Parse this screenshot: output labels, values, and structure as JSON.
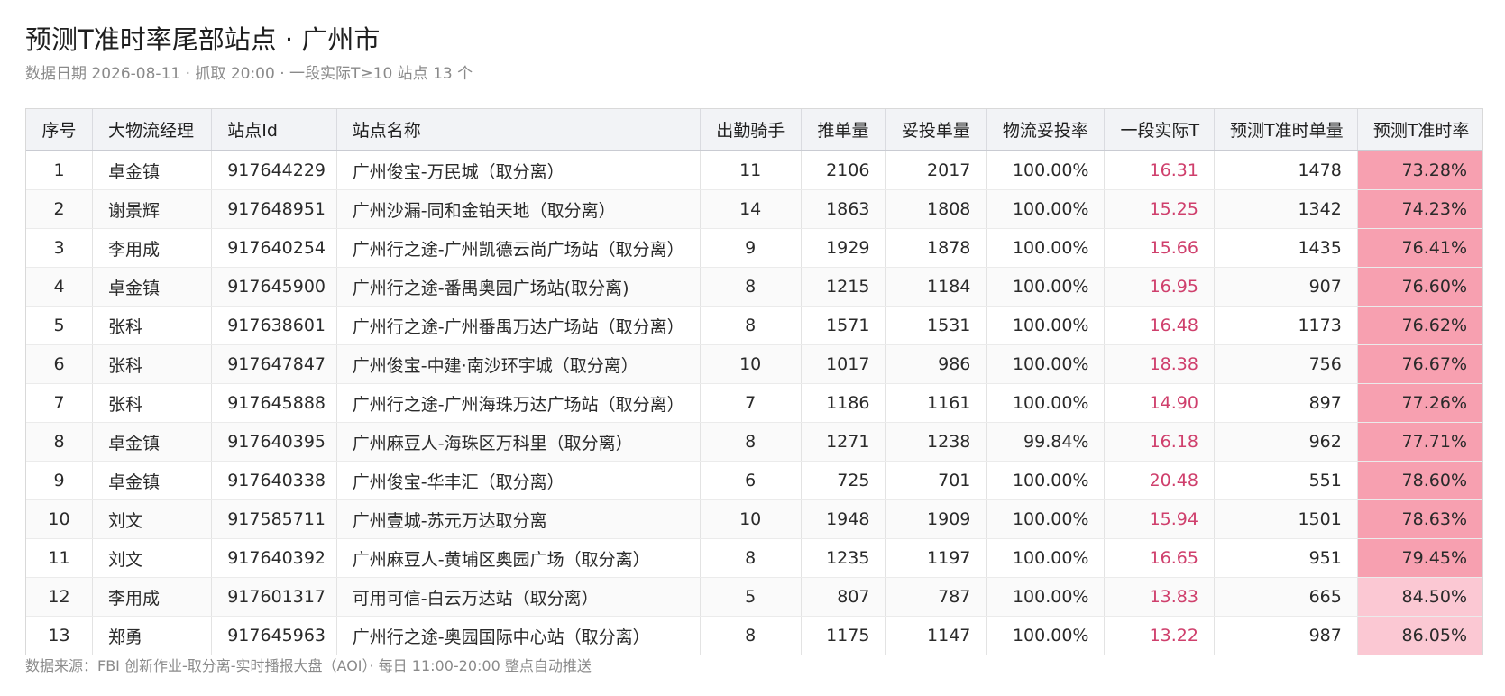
{
  "page": {
    "title": "预测T准时率尾部站点 · 广州市",
    "subtitle": "数据日期 2026-08-11 · 抓取 20:00 · 一段实际T≥10 站点 13 个",
    "footer": "数据来源：FBI 创新作业-取分离-实时播报大盘（AOI）· 每日 11:00-20:00 整点自动推送"
  },
  "colors": {
    "highlight_text": "#cf3f6c",
    "rate_bg_strong": "#f7a0b0",
    "rate_bg_light": "#fbc8d3",
    "header_bg": "#f2f3f6"
  },
  "table": {
    "columns": [
      "序号",
      "大物流经理",
      "站点Id",
      "站点名称",
      "出勤骑手",
      "推单量",
      "妥投单量",
      "物流妥投率",
      "一段实际T",
      "预测T准时单量",
      "预测T准时率"
    ],
    "rows": [
      {
        "cells": [
          "1",
          "卓金镇",
          "917644229",
          "广州俊宝-万民城（取分离）",
          "11",
          "2106",
          "2017",
          "100.00%",
          "16.31",
          "1478",
          "73.28%"
        ],
        "rate_value": 73.28
      },
      {
        "cells": [
          "2",
          "谢景辉",
          "917648951",
          "广州沙漏-同和金铂天地（取分离）",
          "14",
          "1863",
          "1808",
          "100.00%",
          "15.25",
          "1342",
          "74.23%"
        ],
        "rate_value": 74.23
      },
      {
        "cells": [
          "3",
          "李用成",
          "917640254",
          "广州行之途-广州凯德云尚广场站（取分离）",
          "9",
          "1929",
          "1878",
          "100.00%",
          "15.66",
          "1435",
          "76.41%"
        ],
        "rate_value": 76.41
      },
      {
        "cells": [
          "4",
          "卓金镇",
          "917645900",
          "广州行之途-番禺奥园广场站(取分离)",
          "8",
          "1215",
          "1184",
          "100.00%",
          "16.95",
          "907",
          "76.60%"
        ],
        "rate_value": 76.6
      },
      {
        "cells": [
          "5",
          "张科",
          "917638601",
          "广州行之途-广州番禺万达广场站（取分离）",
          "8",
          "1571",
          "1531",
          "100.00%",
          "16.48",
          "1173",
          "76.62%"
        ],
        "rate_value": 76.62
      },
      {
        "cells": [
          "6",
          "张科",
          "917647847",
          "广州俊宝-中建·南沙环宇城（取分离）",
          "10",
          "1017",
          "986",
          "100.00%",
          "18.38",
          "756",
          "76.67%"
        ],
        "rate_value": 76.67
      },
      {
        "cells": [
          "7",
          "张科",
          "917645888",
          "广州行之途-广州海珠万达广场站（取分离）",
          "7",
          "1186",
          "1161",
          "100.00%",
          "14.90",
          "897",
          "77.26%"
        ],
        "rate_value": 77.26
      },
      {
        "cells": [
          "8",
          "卓金镇",
          "917640395",
          "广州麻豆人-海珠区万科里（取分离）",
          "8",
          "1271",
          "1238",
          "99.84%",
          "16.18",
          "962",
          "77.71%"
        ],
        "rate_value": 77.71
      },
      {
        "cells": [
          "9",
          "卓金镇",
          "917640338",
          "广州俊宝-华丰汇（取分离）",
          "6",
          "725",
          "701",
          "100.00%",
          "20.48",
          "551",
          "78.60%"
        ],
        "rate_value": 78.6
      },
      {
        "cells": [
          "10",
          "刘文",
          "917585711",
          "广州壹城-苏元万达取分离",
          "10",
          "1948",
          "1909",
          "100.00%",
          "15.94",
          "1501",
          "78.63%"
        ],
        "rate_value": 78.63
      },
      {
        "cells": [
          "11",
          "刘文",
          "917640392",
          "广州麻豆人-黄埔区奥园广场（取分离）",
          "8",
          "1235",
          "1197",
          "100.00%",
          "16.65",
          "951",
          "79.45%"
        ],
        "rate_value": 79.45
      },
      {
        "cells": [
          "12",
          "李用成",
          "917601317",
          "可用可信-白云万达站（取分离）",
          "5",
          "807",
          "787",
          "100.00%",
          "13.83",
          "665",
          "84.50%"
        ],
        "rate_value": 84.5
      },
      {
        "cells": [
          "13",
          "郑勇",
          "917645963",
          "广州行之途-奥园国际中心站（取分离）",
          "8",
          "1175",
          "1147",
          "100.00%",
          "13.22",
          "987",
          "86.05%"
        ],
        "rate_value": 86.05
      }
    ]
  }
}
